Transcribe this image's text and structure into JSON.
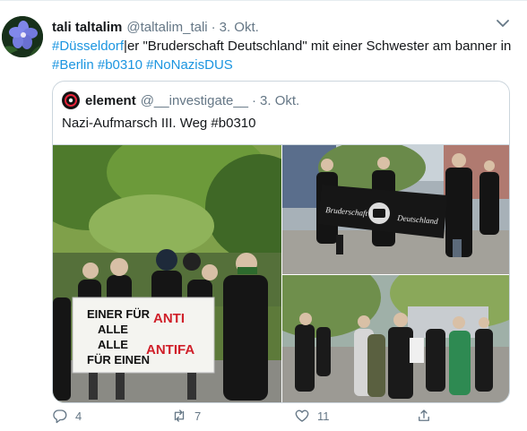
{
  "tweet": {
    "display_name": "tali taltalim",
    "handle": "@taltalim_tali",
    "separator": "·",
    "date": "3. Okt.",
    "text_parts": {
      "tag1": "#Düsseldorf",
      "seg1": "|er \"Bruderschaft Deutschland\" mit einer Schwester am banner in",
      "tag2": "#Berlin",
      "tag3": "#b0310",
      "tag4": "#NoNazisDUS"
    },
    "link_color": "#1b95e0"
  },
  "quote": {
    "display_name": "element",
    "handle": "@__investigate__",
    "separator": "·",
    "date": "3. Okt.",
    "text": "Nazi-Aufmarsch III. Weg #b0310",
    "photos": {
      "banner_left_1": "EINER FÜR",
      "banner_left_2": "ALLE",
      "banner_left_3": "ALLE",
      "banner_left_4": "FÜR EINEN",
      "banner_right_1": "ANTI",
      "banner_right_2": "ANTIFA",
      "banner2_left": "Bruderschaft",
      "banner2_right": "Deutschland"
    }
  },
  "actions": {
    "reply_count": "4",
    "retweet_count": "7",
    "like_count": "11",
    "icons": [
      "reply-icon",
      "retweet-icon",
      "like-icon",
      "share-icon"
    ]
  }
}
